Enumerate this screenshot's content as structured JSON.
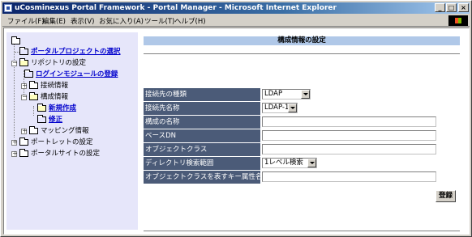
{
  "window": {
    "title": "uCosminexus Portal Framework - Portal Manager - Microsoft Internet Explorer",
    "controls": {
      "minimize": "_",
      "maximize": "□",
      "close": "×"
    }
  },
  "menubar": {
    "items": [
      {
        "label": "ファイル(F)"
      },
      {
        "label": "編集(E)"
      },
      {
        "label": "表示(V)"
      },
      {
        "label": "お気に入り(A)"
      },
      {
        "label": "ツール(T)"
      },
      {
        "label": "ヘルプ(H)"
      }
    ]
  },
  "sidebar": {
    "tree": [
      {
        "label": "",
        "link": false
      },
      {
        "label": "ポータルプロジェクトの選択",
        "link": true
      },
      {
        "label": "リポジトリの設定",
        "link": false,
        "expander": "－"
      },
      {
        "label": "ログインモジュールの登録",
        "link": true
      },
      {
        "label": "接続情報",
        "link": false,
        "expander": "＋"
      },
      {
        "label": "構成情報",
        "link": false,
        "expander": "－"
      },
      {
        "label": "新規作成",
        "link": true
      },
      {
        "label": "修正",
        "link": true
      },
      {
        "label": "マッピング情報",
        "link": false,
        "expander": "＋"
      },
      {
        "label": "ポートレットの設定",
        "link": false,
        "expander": "＋"
      },
      {
        "label": "ポータルサイトの設定",
        "link": false,
        "expander": "＋"
      }
    ]
  },
  "main": {
    "header": "構成情報の設定",
    "form": {
      "connection_type": {
        "label": "接続先の種類",
        "value": "LDAP"
      },
      "connection_name": {
        "label": "接続先名称",
        "value": "LDAP-1"
      },
      "config_name": {
        "label": "構成の名称",
        "value": ""
      },
      "base_dn": {
        "label": "ベースDN",
        "value": ""
      },
      "object_class": {
        "label": "オブジェクトクラス",
        "value": ""
      },
      "search_scope": {
        "label": "ディレクトリ検索範囲",
        "value": "1レベル検索"
      },
      "key_attribute": {
        "label": "オブジェクトクラスを表すキー属性名",
        "value": ""
      }
    },
    "register_button": "登録"
  },
  "colors": {
    "title_gradient_start": "#0a246a",
    "sidebar_bg": "#e6e6fa",
    "header_bg": "#b0c8e8",
    "label_bg": "#4b5b78",
    "link": "#0000cc"
  }
}
